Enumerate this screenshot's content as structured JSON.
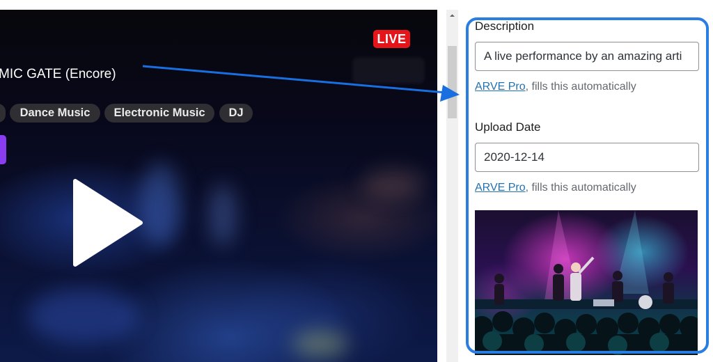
{
  "player": {
    "live_badge": "LIVE",
    "title": "MIC GATE (Encore)",
    "tags": [
      "Dance Music",
      "Electronic Music",
      "DJ"
    ],
    "play_icon": "play-icon"
  },
  "panel": {
    "description": {
      "label": "Description",
      "value": "A live performance by an amazing arti",
      "help_link": "ARVE Pro",
      "help_text": ", fills this automatically"
    },
    "upload_date": {
      "label": "Upload Date",
      "value": "2020-12-14",
      "help_link": "ARVE Pro",
      "help_text": ", fills this automatically"
    },
    "thumbnail_alt": "concert-photo"
  },
  "colors": {
    "live_red": "#e5151b",
    "highlight_blue": "#2a7de1",
    "link_blue": "#2271b1",
    "tag_bg": "#2e2e33"
  }
}
